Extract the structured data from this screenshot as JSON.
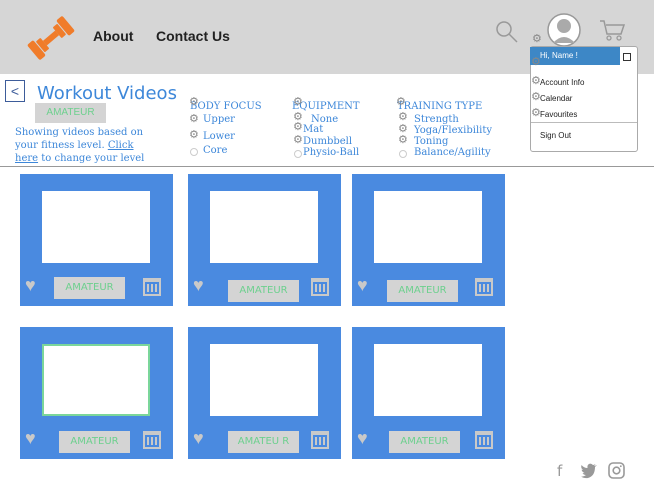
{
  "header": {
    "nav": [
      "About",
      "Contact Us"
    ],
    "icons": [
      "dumbbell-logo-icon",
      "search-icon",
      "avatar-icon",
      "cart-icon"
    ],
    "user_menu": {
      "greeting": "Hi, Name !",
      "items": [
        "Account Info",
        "Calendar",
        "Favourites",
        "Sign Out"
      ]
    }
  },
  "page": {
    "title": "Workout Videos",
    "level_badge": "AMATEUR",
    "showing_text_1": "Showing videos based on your fitness level.",
    "click_here": "Click here",
    "showing_text_2": "to change your level"
  },
  "filters": {
    "body_focus": {
      "title": "BODY FOCUS",
      "options": [
        "Upper",
        "Lower",
        "Core"
      ]
    },
    "equipment": {
      "title": "EQUIPMENT",
      "options": [
        "None",
        "Mat",
        "Dumbbell",
        "Physio-Ball"
      ]
    },
    "training_type": {
      "title": "TRAINING TYPE",
      "options": [
        "Strength",
        "Yoga/Flexibility",
        "Toning",
        "Balance/Agility"
      ]
    }
  },
  "videos": {
    "tags": [
      "AMATEUR",
      "AMATEUR",
      "AMATEUR",
      "AMATEUR",
      "AMATEU R",
      "AMATEUR"
    ]
  },
  "footer": {
    "social": [
      "f",
      "🐦",
      "◎"
    ]
  },
  "colors": {
    "accent": "#3d87d9",
    "card": "#4a8ae0",
    "badge_text": "#6dd08e",
    "logo": "#f07c2a"
  }
}
